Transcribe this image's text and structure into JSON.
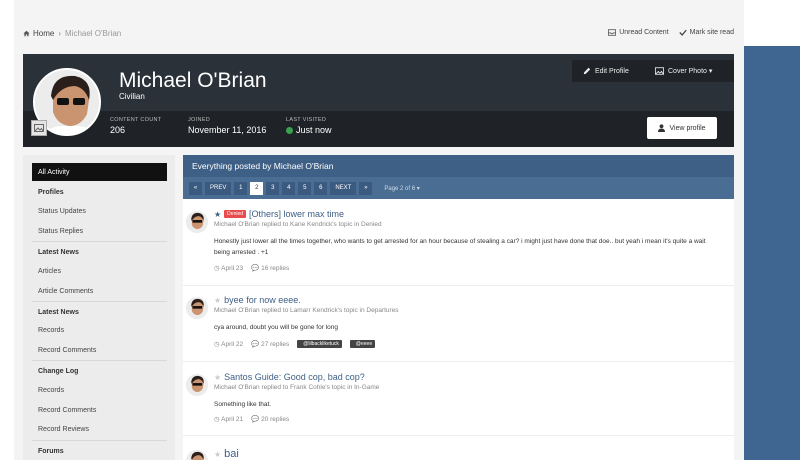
{
  "breadcrumb": {
    "home": "Home",
    "separator": "›",
    "current": "Michael O'Brian"
  },
  "toplinks": {
    "unread": "Unread Content",
    "mark_read": "Mark site read"
  },
  "profile": {
    "name": "Michael O'Brian",
    "rank": "Civilian",
    "content_count_label": "CONTENT COUNT",
    "content_count": "206",
    "joined_label": "JOINED",
    "joined": "November 11, 2016",
    "last_visited_label": "LAST VISITED",
    "last_visited": "Just now",
    "edit_profile": "Edit Profile",
    "cover_photo": "Cover Photo ▾",
    "view_profile": "View profile"
  },
  "sidebar": {
    "all_activity": "All Activity",
    "profiles_hd": "Profiles",
    "status_updates": "Status Updates",
    "status_replies": "Status Replies",
    "latest_news_hd": "Latest News",
    "articles": "Articles",
    "article_comments": "Article Comments",
    "latest_news_hd2": "Latest News",
    "records": "Records",
    "record_comments": "Record Comments",
    "change_log_hd": "Change Log",
    "records2": "Records",
    "record_comments2": "Record Comments",
    "record_reviews": "Record Reviews",
    "forums_hd": "Forums"
  },
  "content": {
    "title": "Everything posted by Michael O'Brian",
    "pager": {
      "first": "«",
      "prev": "PREV",
      "pages": [
        "1",
        "2",
        "3",
        "4",
        "5",
        "6"
      ],
      "next": "NEXT",
      "last": "»",
      "info": "Page 2 of 6 ▾"
    }
  },
  "posts": [
    {
      "badge": "Denied",
      "title": "[Others] lower max time",
      "meta": "Michael O'Brian replied to Kane Kendrick's topic in Denied",
      "body": "Honestly just lower all the times together, who wants to get arrested for an hour because of stealing a car? i might just have done that doe.. but yeah i mean it's quite a wait being arrested . +1",
      "date": "April 23",
      "replies": "16 replies"
    },
    {
      "title": "byee for now eeee.",
      "meta": "Michael O'Brian replied to Lamarr Kendrick's topic in Departures",
      "body": "cya around, doubt you will be gone for long",
      "date": "April 22",
      "replies": "27 replies",
      "tags": [
        "@lilbackliketuck",
        "@eeee"
      ]
    },
    {
      "title": "Santos Guide: Good cop, bad cop?",
      "meta": "Michael O'Brian replied to Frank Cohle's topic in In-Game",
      "body": "Something like that.",
      "date": "April 21",
      "replies": "20 replies"
    },
    {
      "title": "bai"
    }
  ]
}
